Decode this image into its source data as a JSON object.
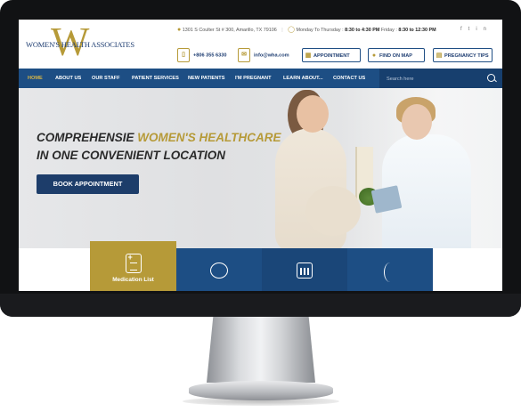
{
  "header": {
    "logo_text": "WOMEN'S HEALTH ASSOCIATES",
    "logo_letter": "W",
    "address": "1301 S Coulter St # 300, Amarillo, TX 79106",
    "hours_label_1": "Monday To Thursday :",
    "hours_value_1": "8:30 to 4:30 PM",
    "hours_label_2": "Friday :",
    "hours_value_2": "8:30 to 12:30 PM",
    "phone": "+806 355 6330",
    "email": "info@wha.com",
    "buttons": {
      "appointment": "APPOINTMENT",
      "find_on_map": "FIND ON MAP",
      "pregnancy_tips": "PREGNANCY TIPS"
    },
    "social": [
      "f",
      "t",
      "in"
    ]
  },
  "nav": {
    "items": [
      "HOME",
      "ABOUT US",
      "OUR STAFF",
      "PATIENT SERVICES",
      "NEW PATIENTS",
      "I'M PREGNANT",
      "LEARN ABOUT...",
      "CONTACT US"
    ],
    "search_placeholder": "Search here"
  },
  "hero": {
    "line1_prefix": "COMPREHENSIE",
    "line1_highlight": "WOMEN'S HEALTHCARE",
    "line2": "IN ONE CONVENIENT LOCATION",
    "button": "BOOK APPOINTMENT"
  },
  "services": {
    "first_label": "Medication List"
  },
  "colors": {
    "navy": "#1d4e84",
    "gold": "#b69a38"
  }
}
